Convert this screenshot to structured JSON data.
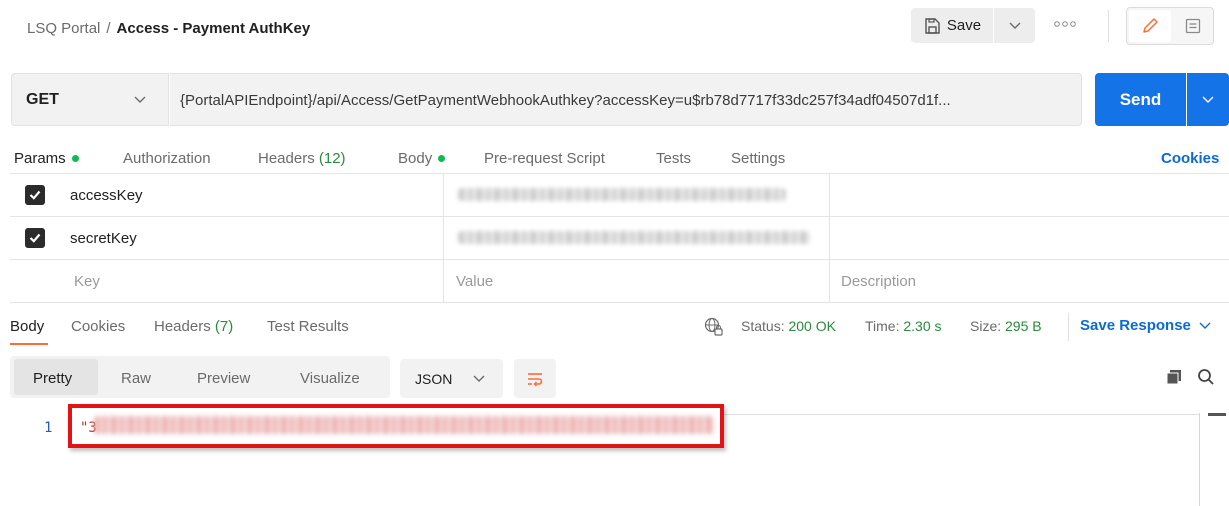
{
  "header": {
    "breadcrumb_parent": "LSQ Portal",
    "breadcrumb_sep": "/",
    "breadcrumb_current": "Access - Payment AuthKey",
    "save_label": "Save"
  },
  "request": {
    "method": "GET",
    "url": "{PortalAPIEndpoint}/api/Access/GetPaymentWebhookAuthkey?accessKey=u$rb78d7717f33dc257f34adf04507d1f...",
    "send_label": "Send"
  },
  "request_tabs": {
    "params": "Params",
    "authorization": "Authorization",
    "headers": "Headers",
    "headers_count": "(12)",
    "body": "Body",
    "pre_request": "Pre-request Script",
    "tests": "Tests",
    "settings": "Settings",
    "cookies": "Cookies"
  },
  "params": {
    "rows": [
      {
        "key": "accessKey",
        "checked": true
      },
      {
        "key": "secretKey",
        "checked": true
      }
    ],
    "placeholders": {
      "key": "Key",
      "value": "Value",
      "description": "Description"
    }
  },
  "response_tabs": {
    "body": "Body",
    "cookies": "Cookies",
    "headers": "Headers",
    "headers_count": "(7)",
    "test_results": "Test Results"
  },
  "response_status": {
    "status_label": "Status:",
    "status_value": "200 OK",
    "time_label": "Time:",
    "time_value": "2.30 s",
    "size_label": "Size:",
    "size_value": "295 B",
    "save_response": "Save Response"
  },
  "response_toolbar": {
    "pretty": "Pretty",
    "raw": "Raw",
    "preview": "Preview",
    "visualize": "Visualize",
    "format": "JSON"
  },
  "response_body": {
    "line_number": "1",
    "string_start": "\"3"
  },
  "colors": {
    "send_blue": "#1473e6",
    "link_blue": "#0b6bd3",
    "status_green": "#2b8a3e",
    "dot_green": "#0cbb52",
    "active_underline": "#ff6c37",
    "highlight_red": "#e01414"
  },
  "icons": [
    "save-icon",
    "chevron-down-icon",
    "more-icon",
    "pencil-icon",
    "document-icon",
    "globe-lock-icon",
    "wrap-lines-icon",
    "copy-icon",
    "search-icon",
    "checkbox-checked-icon"
  ]
}
